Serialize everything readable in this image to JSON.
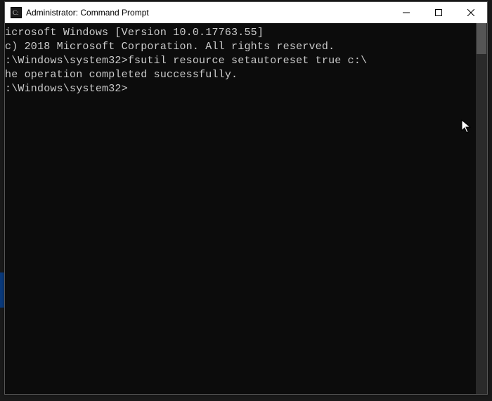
{
  "title": "Administrator: Command Prompt",
  "lines": {
    "l1": "icrosoft Windows [Version 10.0.17763.55]",
    "l2": "c) 2018 Microsoft Corporation. All rights reserved.",
    "l3": "",
    "l4": ":\\Windows\\system32>fsutil resource setautoreset true c:\\",
    "l5": "he operation completed successfully.",
    "l6": "",
    "l7": ":\\Windows\\system32>"
  }
}
